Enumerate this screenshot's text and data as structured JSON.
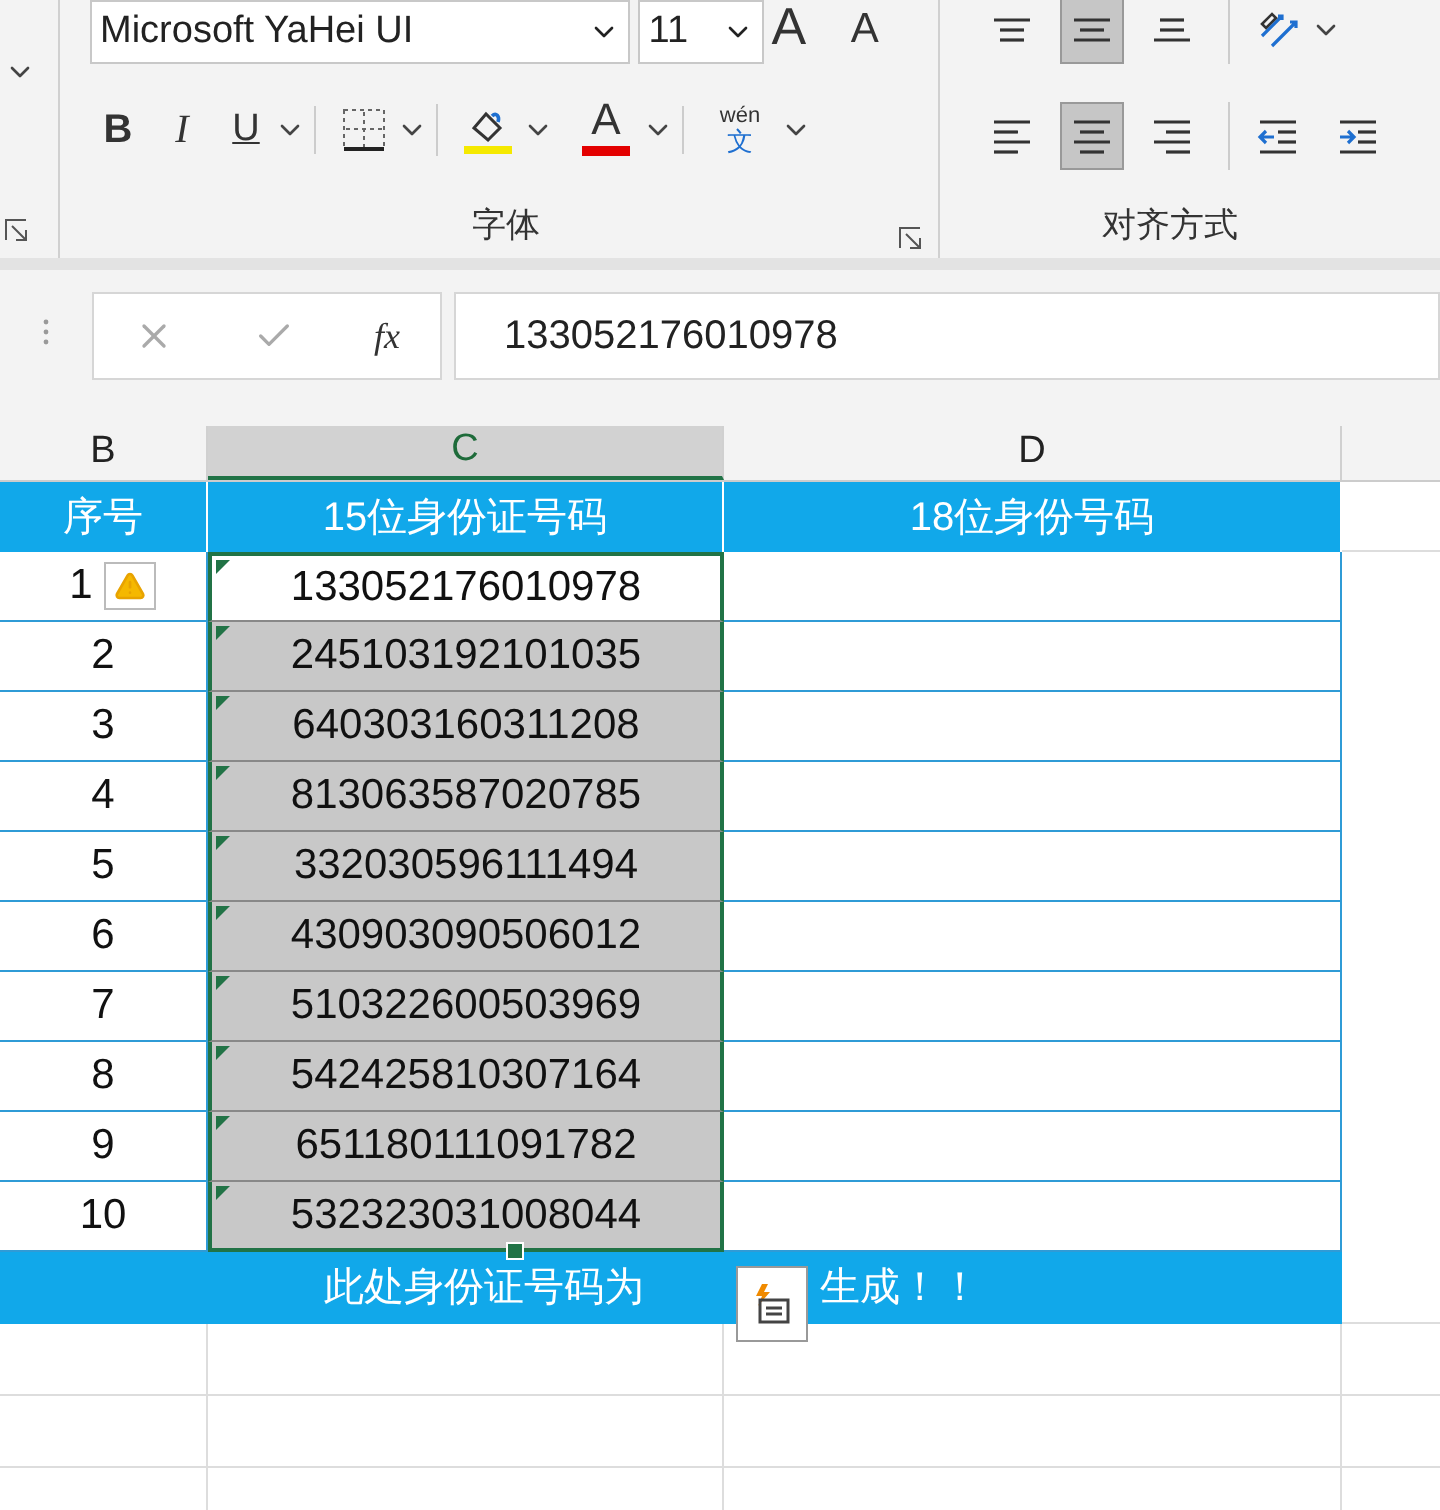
{
  "ribbon": {
    "font_name": "Microsoft YaHei UI",
    "font_size": "11",
    "size_buttons": [
      {
        "kind": "grow",
        "label": "A"
      },
      {
        "kind": "shrink",
        "label": "A"
      }
    ],
    "format_buttons": [
      {
        "kind": "bold",
        "label": "B"
      },
      {
        "kind": "italic",
        "label": "I"
      },
      {
        "kind": "underline",
        "label": "U"
      },
      {
        "kind": "border"
      },
      {
        "kind": "fill"
      },
      {
        "kind": "font_color",
        "label": "A"
      },
      {
        "kind": "phonetic",
        "label": "wén",
        "sub": "文"
      }
    ],
    "font_group_label": "字体",
    "align_top": [
      {
        "kind": "top",
        "selected": false
      },
      {
        "kind": "middle",
        "selected": true
      },
      {
        "kind": "bottom",
        "selected": false
      },
      {
        "kind": "orientation",
        "selected": false
      }
    ],
    "align_bottom": [
      {
        "kind": "left",
        "selected": false
      },
      {
        "kind": "center",
        "selected": true
      },
      {
        "kind": "right",
        "selected": false
      },
      {
        "kind": "outdent",
        "selected": false
      },
      {
        "kind": "indent",
        "selected": false
      }
    ],
    "alignment_group_label": "对齐方式"
  },
  "formula_bar": {
    "function_label": "fx",
    "value": "133052176010978"
  },
  "columns": [
    {
      "label": "B",
      "selected": false
    },
    {
      "label": "C",
      "selected": true
    },
    {
      "label": "D",
      "selected": false
    }
  ],
  "header_row": [
    "序号",
    "15位身份证号码",
    "18位身份号码"
  ],
  "rows": [
    {
      "index": "1",
      "id": "133052176010978",
      "selected": false,
      "warning": true
    },
    {
      "index": "2",
      "id": "245103192101035",
      "selected": true,
      "warning": false
    },
    {
      "index": "3",
      "id": "640303160311208",
      "selected": true,
      "warning": false
    },
    {
      "index": "4",
      "id": "813063587020785",
      "selected": true,
      "warning": false
    },
    {
      "index": "5",
      "id": "332030596111494",
      "selected": true,
      "warning": false
    },
    {
      "index": "6",
      "id": "430903090506012",
      "selected": true,
      "warning": false
    },
    {
      "index": "7",
      "id": "510322600503969",
      "selected": true,
      "warning": false
    },
    {
      "index": "8",
      "id": "542425810307164",
      "selected": true,
      "warning": false
    },
    {
      "index": "9",
      "id": "651180111091782",
      "selected": true,
      "warning": false
    },
    {
      "index": "10",
      "id": "532323031008044",
      "selected": true,
      "warning": false
    }
  ],
  "footer": {
    "before": "此处身份证号码为",
    "after": "生成！！"
  }
}
